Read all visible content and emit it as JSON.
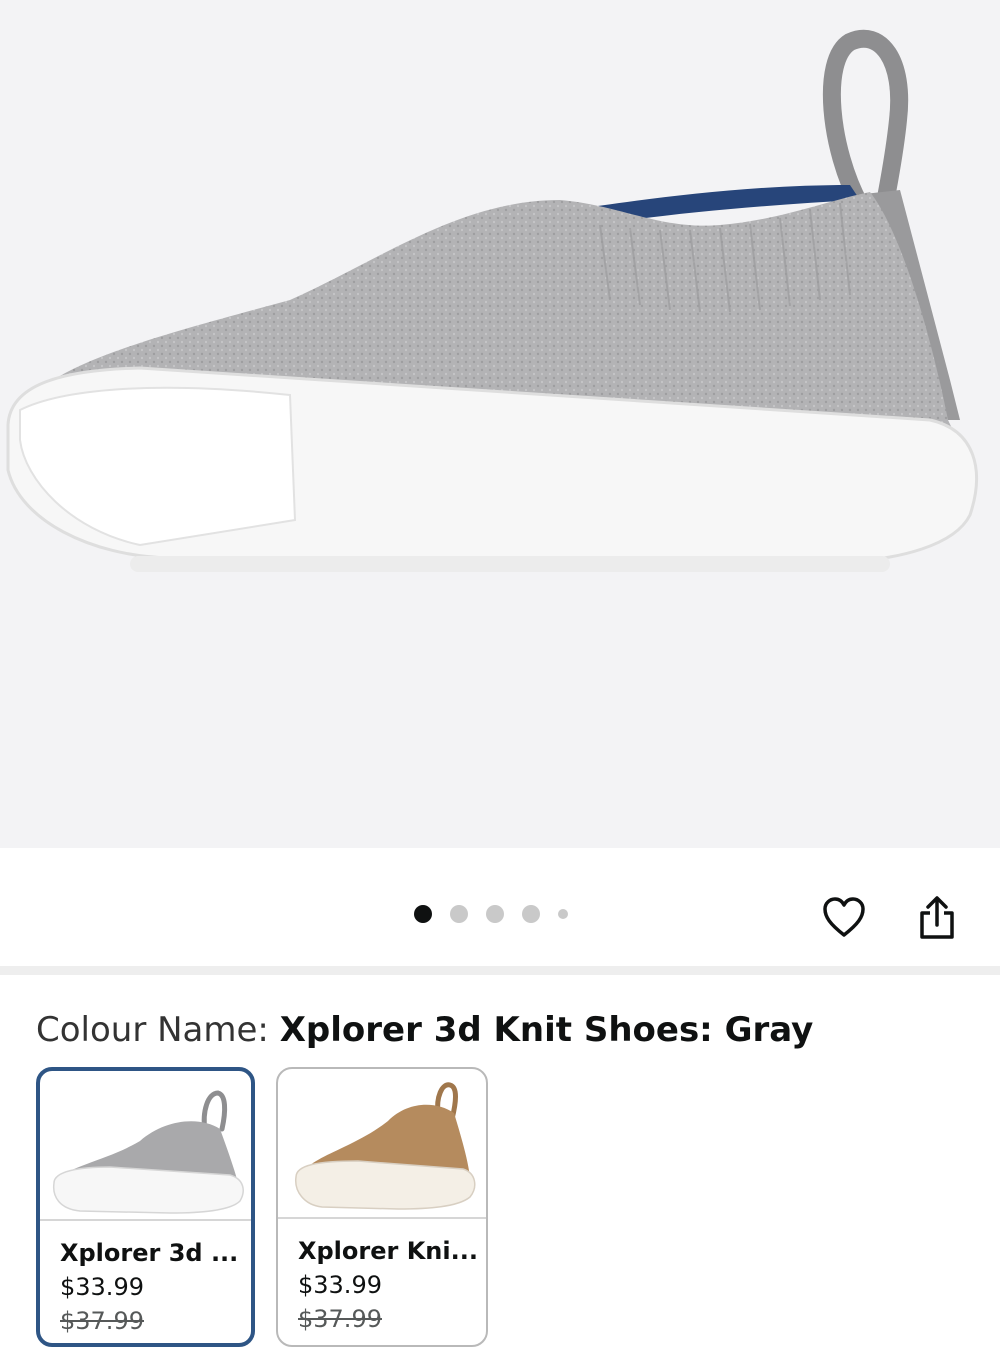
{
  "gallery": {
    "image_alt": "Xplorer 3d Knit Shoes: Gray",
    "image_count": 5,
    "active_index": 0
  },
  "actions": {
    "favorite_icon": "heart-icon",
    "share_icon": "share-icon"
  },
  "colour": {
    "label": "Colour Name: ",
    "value": "Xplorer 3d Knit Shoes: Gray"
  },
  "swatches": [
    {
      "name": "Xplorer 3d ...",
      "price": "$33.99",
      "list_price": "$37.99",
      "selected": true,
      "color": "#a9a9ab"
    },
    {
      "name": "Xplorer Kni...",
      "price": "$33.99",
      "list_price": "$37.99",
      "selected": false,
      "color": "#b58b5e"
    }
  ],
  "colors": {
    "selected_border": "#2e5585",
    "text": "#0f1111"
  }
}
